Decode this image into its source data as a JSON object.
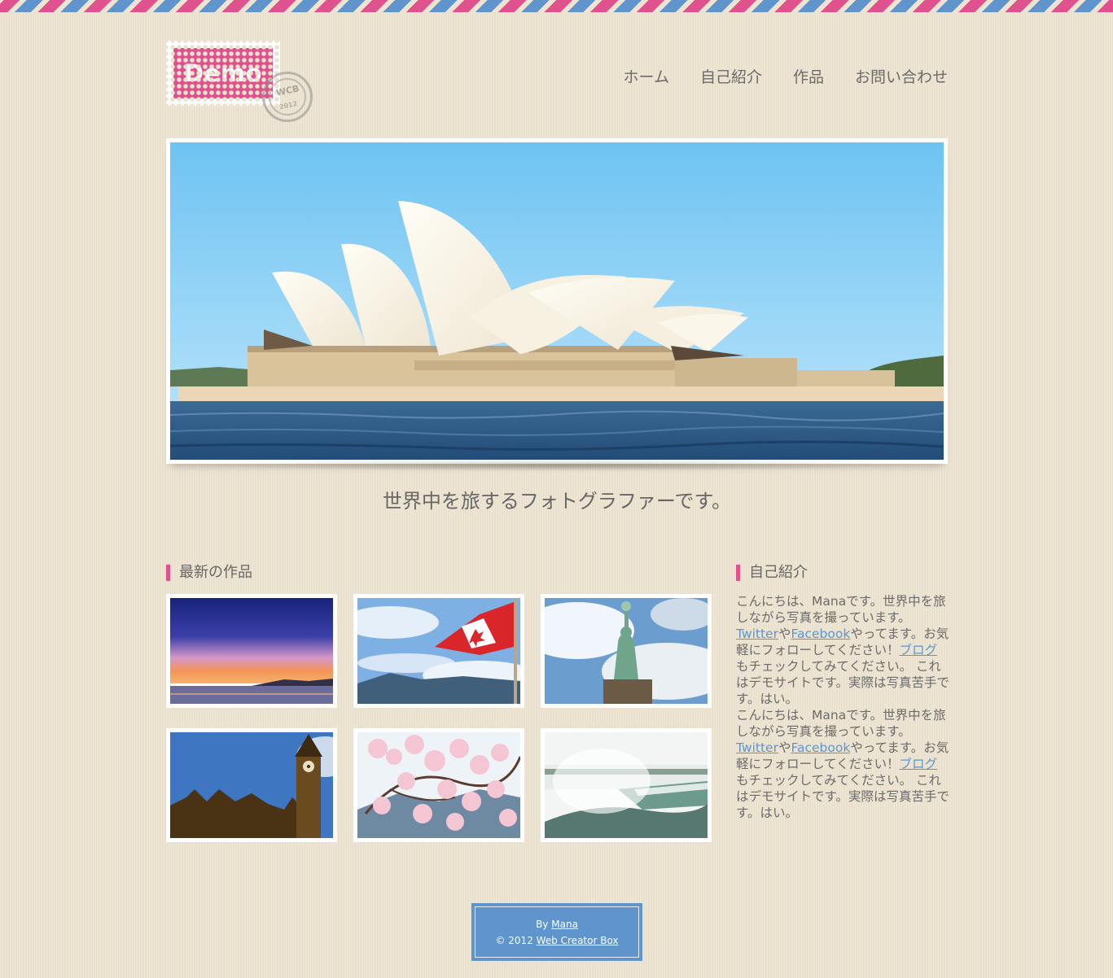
{
  "header": {
    "logo_text": "Demo",
    "postmark_text": "WCB",
    "postmark_year": "2012"
  },
  "nav": [
    {
      "label": "ホーム"
    },
    {
      "label": "自己紹介"
    },
    {
      "label": "作品"
    },
    {
      "label": "お問い合わせ"
    }
  ],
  "hero": {
    "tagline": "世界中を旅するフォトグラファーです。"
  },
  "works": {
    "title": "最新の作品"
  },
  "about": {
    "title": "自己紹介",
    "blocks": [
      {
        "line1": "こんにちは、Manaです。世界中を旅しながら写真を撮っています。",
        "twitter": "Twitter",
        "ya": "や",
        "facebook": "Facebook",
        "line2": "やってます。お気軽にフォローしてください！",
        "blog": "ブログ",
        "line3": "もチェックしてみてください。 これはデモサイトです。実際は写真苦手です。はい。"
      },
      {
        "line1": "こんにちは、Manaです。世界中を旅しながら写真を撮っています。",
        "twitter": "Twitter",
        "ya": "や",
        "facebook": "Facebook",
        "line2": "やってます。お気軽にフォローしてください！",
        "blog": "ブログ",
        "line3": "もチェックしてみてください。 これはデモサイトです。実際は写真苦手です。はい。"
      }
    ]
  },
  "footer": {
    "by": "By",
    "author": "Mana",
    "copyright": "© 2012",
    "site": "Web Creator Box"
  },
  "colors": {
    "accent_pink": "#e0528d",
    "accent_blue": "#5f95cc",
    "background": "#ede4d1"
  }
}
